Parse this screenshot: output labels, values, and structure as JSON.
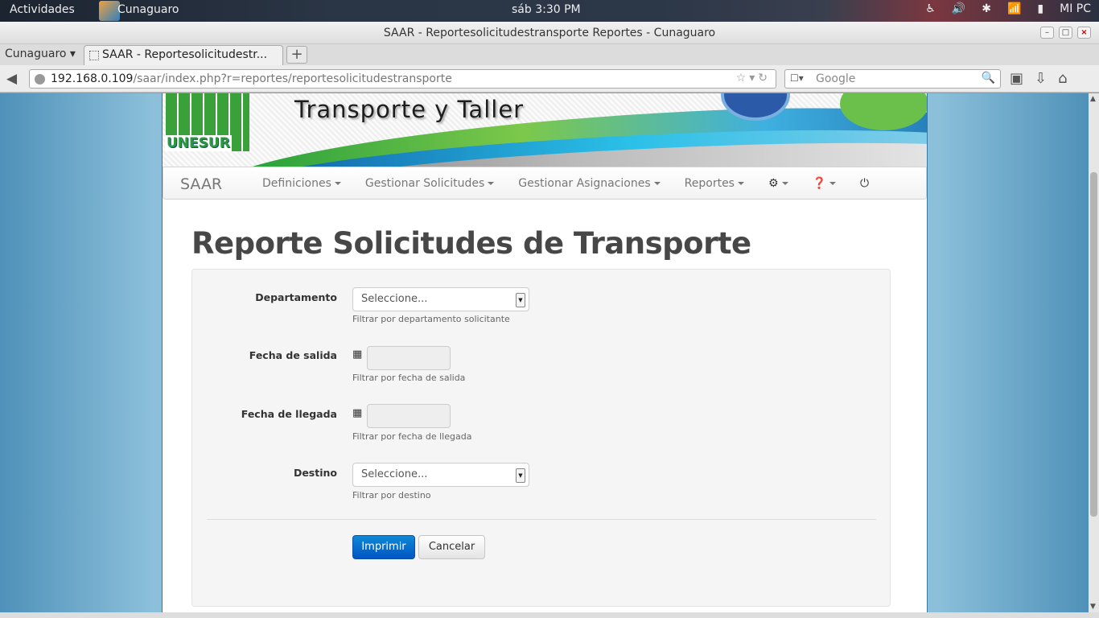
{
  "desktop": {
    "activities": "Actividades",
    "app_name": "Cunaguaro",
    "clock": "sáb  3:30 PM",
    "user": "MI PC"
  },
  "window": {
    "title": "SAAR - Reportesolicitudestransporte Reportes - Cunaguaro"
  },
  "browser": {
    "tab_group": "Cunaguaro",
    "tab_title": "SAAR - Reportesolicitudestr...",
    "url_host": "192.168.0.109",
    "url_path": "/saar/index.php?r=reportes/reportesolicitudestransporte",
    "search_placeholder": "Google"
  },
  "banner": {
    "title": "Transporte y Taller",
    "logo_text": "UNESUR"
  },
  "nav": {
    "brand": "SAAR",
    "items": [
      "Definiciones",
      "Gestionar Solicitudes",
      "Gestionar Asignaciones",
      "Reportes"
    ]
  },
  "page": {
    "title": "Reporte Solicitudes de Transporte"
  },
  "form": {
    "departamento": {
      "label": "Departamento",
      "value": "Seleccione...",
      "help": "Filtrar por departamento solicitante"
    },
    "fecha_salida": {
      "label": "Fecha de salida",
      "value": "",
      "help": "Filtrar por fecha de salida"
    },
    "fecha_llegada": {
      "label": "Fecha de llegada",
      "value": "",
      "help": "Filtrar por fecha de llegada"
    },
    "destino": {
      "label": "Destino",
      "value": "Seleccione...",
      "help": "Filtrar por destino"
    },
    "print_button": "Imprimir",
    "cancel_button": "Cancelar"
  },
  "colors": {
    "primary_button": "#0155c4",
    "page_background": "#8cc0da"
  }
}
